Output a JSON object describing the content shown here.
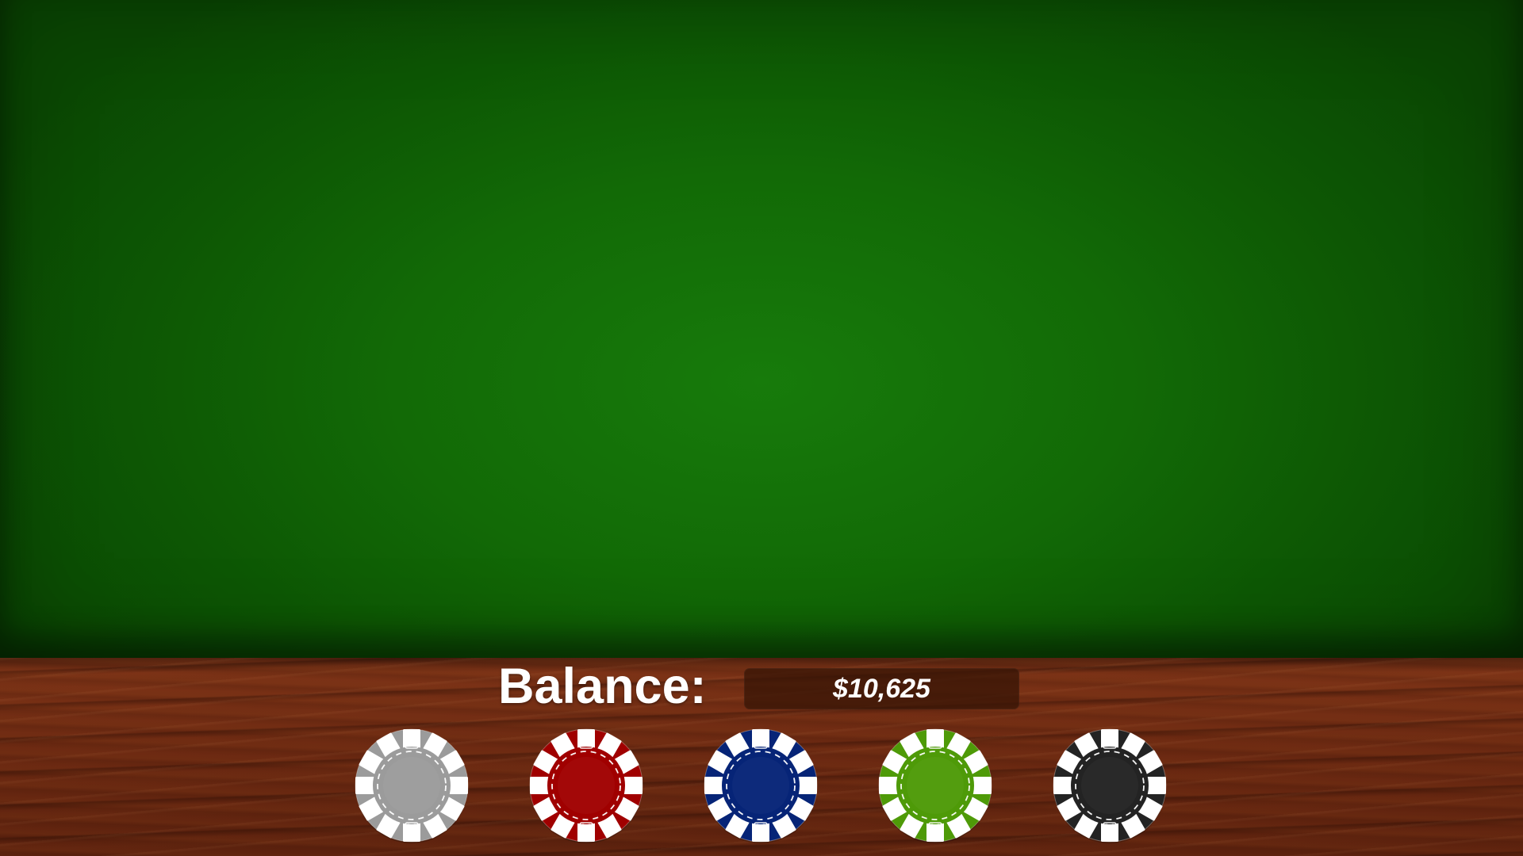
{
  "balance": {
    "label": "Balance:",
    "value": "$10,625"
  },
  "chips": [
    {
      "name": "white-chip",
      "color": "#9b9b9b"
    },
    {
      "name": "red-chip",
      "color": "#a00000"
    },
    {
      "name": "blue-chip",
      "color": "#062477"
    },
    {
      "name": "green-chip",
      "color": "#4e9a08"
    },
    {
      "name": "black-chip",
      "color": "#232323"
    }
  ],
  "colors": {
    "felt": "#137008",
    "rail": "#6e2a12",
    "balance_box": "#361406",
    "chip_stripe": "#ffffff"
  },
  "icons": [
    "poker-chip-icon",
    "dice-icon"
  ]
}
